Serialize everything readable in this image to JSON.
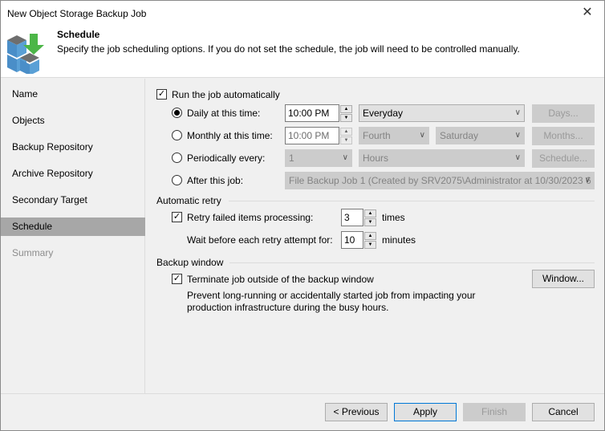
{
  "window": {
    "title": "New Object Storage Backup Job",
    "close_icon": "close-icon"
  },
  "header": {
    "title": "Schedule",
    "description": "Specify the job scheduling options. If you do not set the schedule, the job will need to be controlled manually."
  },
  "sidebar": {
    "items": [
      {
        "label": "Name"
      },
      {
        "label": "Objects"
      },
      {
        "label": "Backup Repository"
      },
      {
        "label": "Archive Repository"
      },
      {
        "label": "Secondary Target"
      },
      {
        "label": "Schedule",
        "selected": true
      },
      {
        "label": "Summary",
        "disabled": true
      }
    ]
  },
  "schedule": {
    "run_automatically": {
      "label": "Run the job automatically",
      "checked": true
    },
    "daily": {
      "label": "Daily at this time:",
      "selected": true,
      "time": "10:00 PM",
      "days": "Everyday",
      "button": "Days..."
    },
    "monthly": {
      "label": "Monthly at this time:",
      "time": "10:00 PM",
      "week": "Fourth",
      "day": "Saturday",
      "button": "Months..."
    },
    "periodically": {
      "label": "Periodically every:",
      "value": "1",
      "unit": "Hours",
      "button": "Schedule..."
    },
    "after": {
      "label": "After this job:",
      "job": "File Backup Job 1 (Created by SRV2075\\Administrator at 10/30/2023 6"
    }
  },
  "retry": {
    "section": "Automatic retry",
    "retry_label": "Retry failed items processing:",
    "retry_checked": true,
    "retry_count": "3",
    "times": "times",
    "wait_label": "Wait before each retry attempt for:",
    "wait": "10",
    "minutes": "minutes"
  },
  "backup_window": {
    "section": "Backup window",
    "terminate_label": "Terminate job outside of the backup window",
    "checked": true,
    "description1": "Prevent long-running or accidentally started job from impacting your",
    "description2": "production infrastructure during the busy hours.",
    "button": "Window..."
  },
  "footer": {
    "previous": "< Previous",
    "apply": "Apply",
    "finish": "Finish",
    "cancel": "Cancel"
  }
}
